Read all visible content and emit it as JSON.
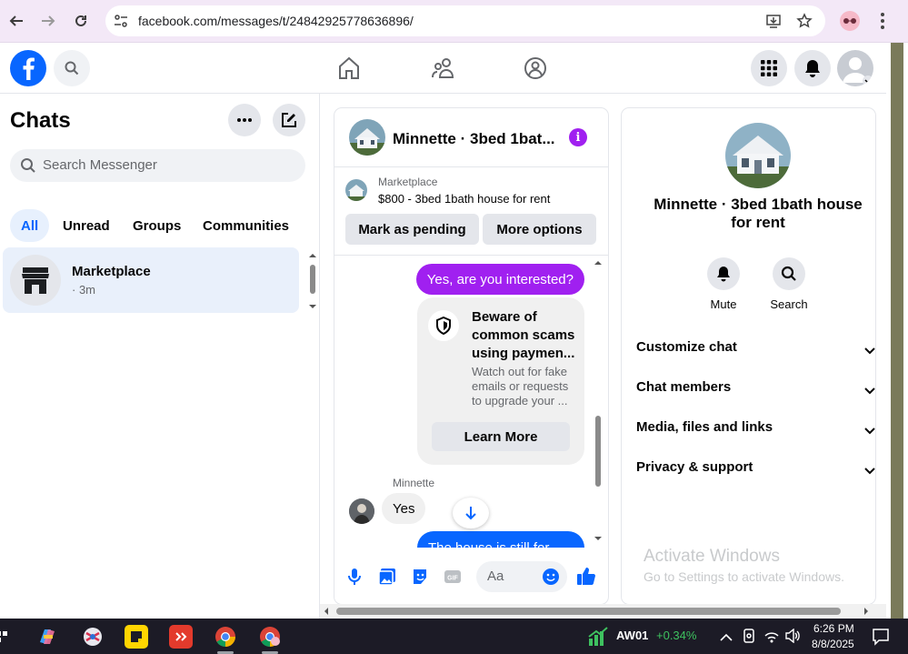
{
  "browser": {
    "url": "facebook.com/messages/t/24842925778636896/"
  },
  "sidebar": {
    "title": "Chats",
    "search_placeholder": "Search Messenger",
    "filters": [
      {
        "label": "All",
        "active": true
      },
      {
        "label": "Unread",
        "active": false
      },
      {
        "label": "Groups",
        "active": false
      },
      {
        "label": "Communities",
        "active": false
      }
    ],
    "chats": [
      {
        "name": "Marketplace",
        "meta": "· 3m"
      }
    ]
  },
  "conversation": {
    "title": "Minnette · 3bed 1bat...",
    "marketplace_label": "Marketplace",
    "listing": "$800 - 3bed 1bath house for rent",
    "mark_pending_label": "Mark as pending",
    "more_options_label": "More options",
    "messages": {
      "outgoing_1": "Yes, are you interested?",
      "scam_title": "Beware of common scams using paymen...",
      "scam_body": "Watch out for fake emails or requests to upgrade your ...",
      "learn_more": "Learn More",
      "sender": "Minnette",
      "incoming_1": "Yes",
      "outgoing_2": "The house is still for"
    },
    "composer_placeholder": "Aa"
  },
  "info_panel": {
    "title": "Minnette · 3bed 1bath house for rent",
    "actions": [
      {
        "label": "Mute",
        "icon": "bell-icon"
      },
      {
        "label": "Search",
        "icon": "search-icon"
      }
    ],
    "sections": [
      "Customize chat",
      "Chat members",
      "Media, files and links",
      "Privacy & support"
    ]
  },
  "watermark": {
    "line1": "Activate Windows",
    "line2": "Go to Settings to activate Windows."
  },
  "taskbar": {
    "ticker": "AW01",
    "change": "+0.34%",
    "time": "6:26 PM",
    "date": "8/8/2025"
  },
  "colors": {
    "fb_blue": "#0866ff",
    "accent_purple": "#a020f0",
    "ticker_green": "#3ec15f"
  }
}
